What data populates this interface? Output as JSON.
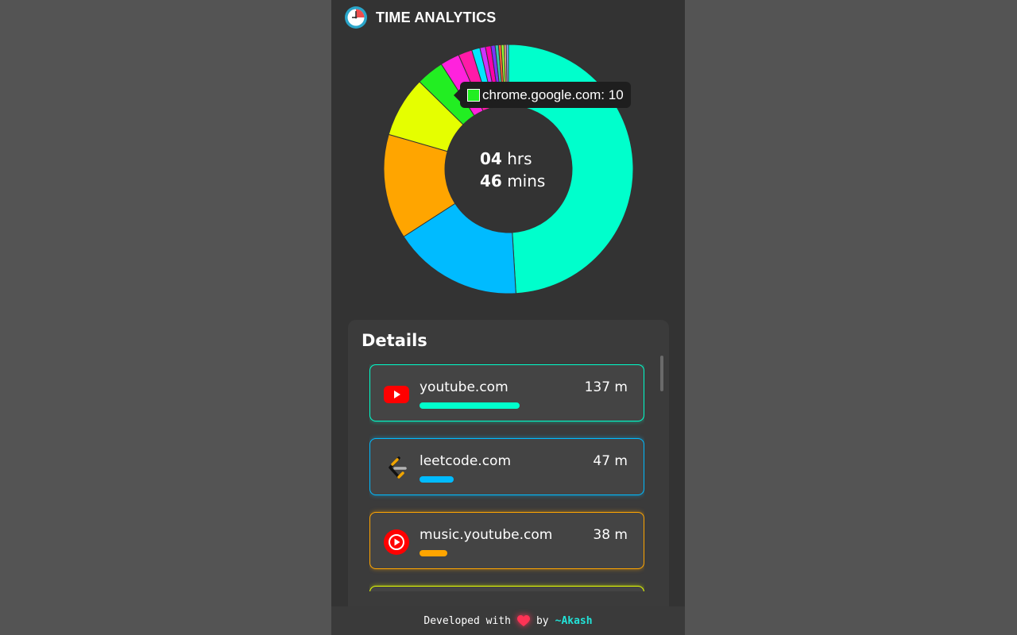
{
  "header": {
    "title": "TIME ANALYTICS"
  },
  "total": {
    "hours": "04",
    "hours_unit": "hrs",
    "minutes": "46",
    "minutes_unit": "mins"
  },
  "tooltip": {
    "text": "chrome.google.com: 10",
    "color": "#22ee22"
  },
  "chart_data": {
    "type": "pie",
    "slices": [
      {
        "label": "youtube.com",
        "value": 137,
        "color": "#00ffcc"
      },
      {
        "label": "leetcode.com",
        "value": 47,
        "color": "#00bbff"
      },
      {
        "label": "music.youtube.com",
        "value": 38,
        "color": "#ffa500"
      },
      {
        "label": "",
        "value": 22,
        "color": "#e5ff00"
      },
      {
        "label": "chrome.google.com",
        "value": 10,
        "color": "#22ee22"
      },
      {
        "label": "",
        "value": 7,
        "color": "#ff22dd"
      },
      {
        "label": "",
        "value": 5,
        "color": "#ff1aa8"
      },
      {
        "label": "",
        "value": 3,
        "color": "#00e6ff"
      },
      {
        "label": "",
        "value": 2,
        "color": "#cc33ff"
      },
      {
        "label": "",
        "value": 2,
        "color": "#ff00aa"
      },
      {
        "label": "",
        "value": 1.5,
        "color": "#7a33ff"
      },
      {
        "label": "",
        "value": 1.2,
        "color": "#33ccaa"
      },
      {
        "label": "",
        "value": 1,
        "color": "#ff6633"
      },
      {
        "label": "",
        "value": 1,
        "color": "#99ff33"
      },
      {
        "label": "",
        "value": 0.8,
        "color": "#ffaa88"
      },
      {
        "label": "",
        "value": 0.8,
        "color": "#88aaff"
      }
    ]
  },
  "details": {
    "title": "Details",
    "items": [
      {
        "name": "youtube.com",
        "time": "137 m",
        "fraction": 1.0,
        "color": "#00ffcc",
        "icon": "youtube-icon"
      },
      {
        "name": "leetcode.com",
        "time": "47 m",
        "fraction": 0.343,
        "color": "#00bbff",
        "icon": "leetcode-icon"
      },
      {
        "name": "music.youtube.com",
        "time": "38 m",
        "fraction": 0.277,
        "color": "#ffa500",
        "icon": "youtube-music-icon"
      }
    ],
    "partial_item_color": "#e5ff00"
  },
  "footer": {
    "prefix": "Developed with",
    "by": "by",
    "author": "~Akash"
  }
}
